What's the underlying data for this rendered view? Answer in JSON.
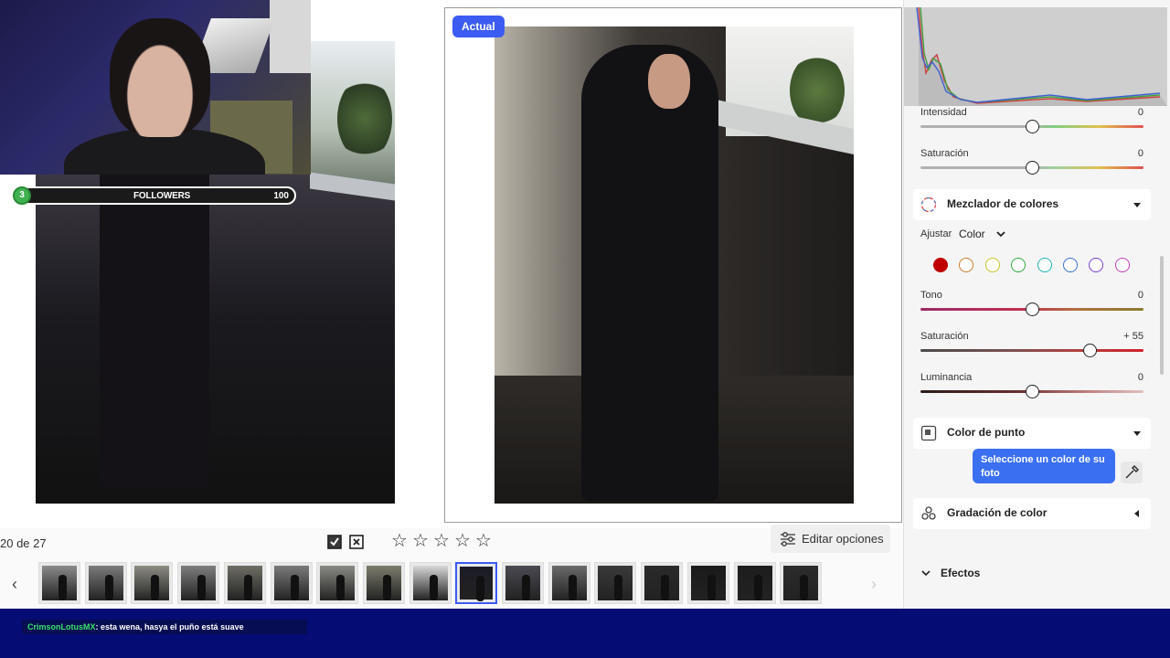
{
  "viewer": {
    "current_badge": "Actual",
    "counter": "20 de 27",
    "rating_stars": 5,
    "edit_options_label": "Editar opciones",
    "selected_thumbnail_index": 9,
    "thumbnail_count": 17
  },
  "stream_overlay": {
    "followers_current": "3",
    "followers_label": "FOLLOWERS",
    "followers_goal": "100",
    "chat_user": "CrimsonLotusMX",
    "chat_text": ": esta wena, hasya el puño está suave"
  },
  "panel": {
    "top_sliders": [
      {
        "label": "Intensidad",
        "value": "0",
        "position": 0.5
      },
      {
        "label": "Saturación",
        "value": "0",
        "position": 0.5
      }
    ],
    "color_mixer": {
      "title": "Mezclador de colores",
      "adjust_label": "Ajustar",
      "adjust_value": "Color",
      "swatches": [
        "#c00000",
        "#d27a2a",
        "#c9c227",
        "#2ea83a",
        "#1fb2b2",
        "#3a6fd8",
        "#7a3ed0",
        "#c43fbf"
      ],
      "selected_swatch": 0,
      "sliders": [
        {
          "label": "Tono",
          "value": "0",
          "position": 0.5
        },
        {
          "label": "Saturación",
          "value": "+ 55",
          "position": 0.76
        },
        {
          "label": "Luminancia",
          "value": "0",
          "position": 0.5
        }
      ]
    },
    "point_color": {
      "title": "Color de punto",
      "tooltip": "Seleccione un color de su foto"
    },
    "color_grading": {
      "title": "Gradación de color"
    },
    "effects": {
      "title": "Efectos"
    }
  }
}
